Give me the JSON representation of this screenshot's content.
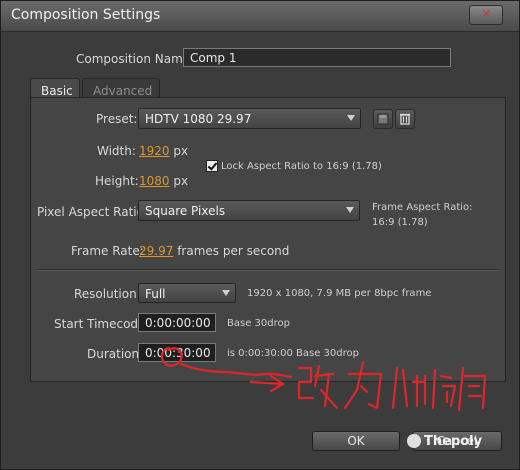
{
  "window": {
    "title": "Composition Settings"
  },
  "comp_name": {
    "label": "Composition Name:",
    "value": "Comp 1"
  },
  "tabs": [
    {
      "label": "Basic"
    },
    {
      "label": "Advanced"
    }
  ],
  "preset": {
    "label": "Preset:",
    "value": "HDTV 1080 29.97"
  },
  "width": {
    "label": "Width:",
    "value": "1920",
    "unit": "px"
  },
  "height": {
    "label": "Height:",
    "value": "1080",
    "unit": "px"
  },
  "lock_aspect": {
    "label": "Lock Aspect Ratio to 16:9 (1.78)",
    "checked": true
  },
  "pixel_aspect": {
    "label": "Pixel Aspect Ratio:",
    "value": "Square Pixels",
    "frame_aspect_label": "Frame Aspect Ratio:",
    "frame_aspect_value": "16:9 (1.78)"
  },
  "frame_rate": {
    "label": "Frame Rate:",
    "value": "29.97",
    "unit": "frames per second"
  },
  "resolution": {
    "label": "Resolution:",
    "value": "Full",
    "info": "1920 x 1080, 7.9 MB per 8bpc frame"
  },
  "start_timecode": {
    "label": "Start Timecode:",
    "value": "0:00:00:00",
    "note": "Base 30drop"
  },
  "duration": {
    "label": "Duration:",
    "value": "0:00:30:00",
    "note": "is 0:00:30:00  Base 30drop"
  },
  "buttons": {
    "ok": "OK",
    "cancel": "Cancel"
  },
  "annotation": {
    "handwriting": "改为1帧",
    "color": "#e0262a"
  },
  "watermark": {
    "text": "Thepoly"
  },
  "icons": [
    "close-icon",
    "save-preset-icon",
    "trash-icon",
    "dropdown-arrow-icon",
    "checkmark-icon",
    "wechat-icon"
  ]
}
